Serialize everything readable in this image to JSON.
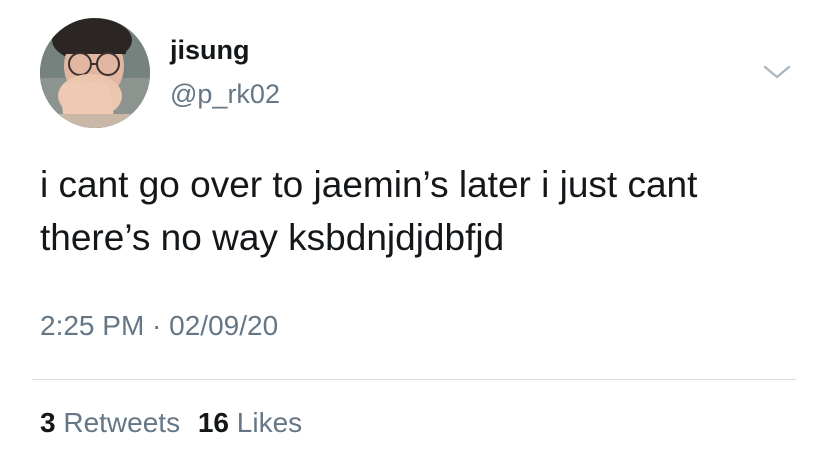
{
  "user": {
    "display_name": "jisung",
    "handle": "@p_rk02"
  },
  "tweet": {
    "lines": [
      "i cant go over to jaemin’s later i just cant",
      "there’s no way ksbdnjdjdbfjd"
    ],
    "timestamp": "2:25 PM · 02/09/20"
  },
  "stats": {
    "retweets_count": "3",
    "retweets_label": "Retweets",
    "likes_count": "16",
    "likes_label": "Likes"
  },
  "icons": {
    "more_menu": "chevron-down-icon"
  },
  "colors": {
    "text_primary": "#14171a",
    "text_secondary": "#657786",
    "divider": "#d6dbe0",
    "background": "#ffffff"
  }
}
